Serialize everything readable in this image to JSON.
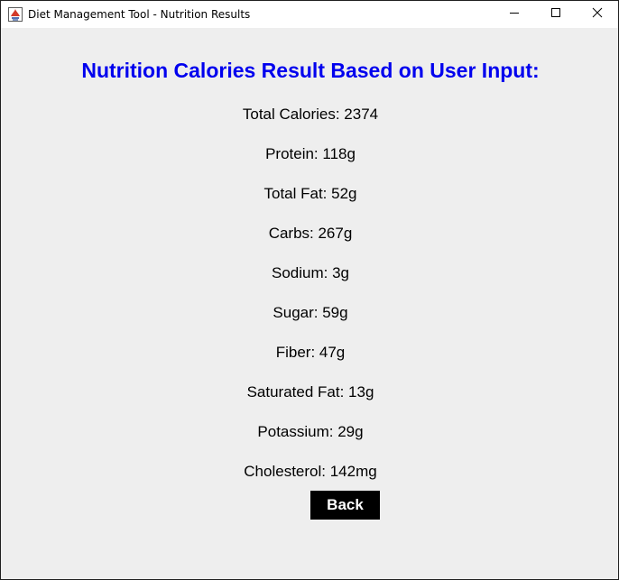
{
  "window": {
    "title": "Diet Management Tool - Nutrition Results",
    "controls": {
      "minimize_icon": "minimize-icon",
      "maximize_icon": "maximize-icon",
      "close_icon": "close-icon"
    }
  },
  "page": {
    "heading": "Nutrition Calories Result Based on User Input:",
    "heading_color": "#0000ee",
    "background_color": "#eeeeee"
  },
  "results": [
    {
      "label": "Total Calories: 2374"
    },
    {
      "label": "Protein: 118g"
    },
    {
      "label": "Total Fat: 52g"
    },
    {
      "label": "Carbs: 267g"
    },
    {
      "label": "Sodium: 3g"
    },
    {
      "label": "Sugar: 59g"
    },
    {
      "label": "Fiber: 47g"
    },
    {
      "label": "Saturated Fat: 13g"
    },
    {
      "label": "Potassium: 29g"
    },
    {
      "label": "Cholesterol: 142mg"
    }
  ],
  "actions": {
    "back_label": "Back",
    "back_bg": "#000000",
    "back_fg": "#ffffff"
  }
}
